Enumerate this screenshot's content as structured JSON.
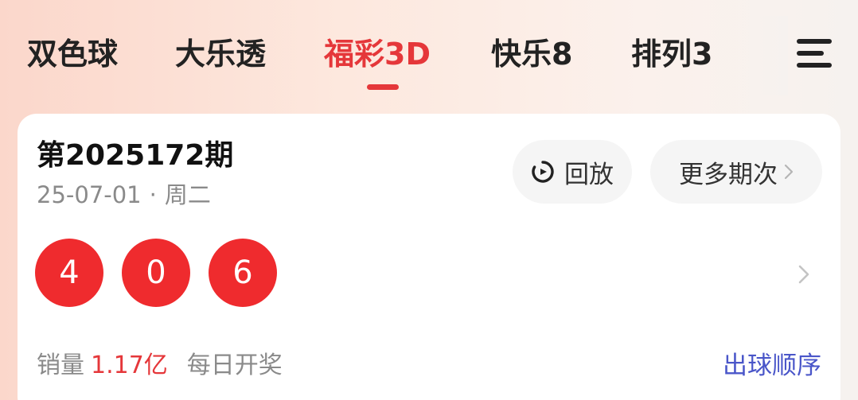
{
  "tabs": [
    {
      "label": "双色球",
      "active": false
    },
    {
      "label": "大乐透",
      "active": false
    },
    {
      "label": "福彩3D",
      "active": true
    },
    {
      "label": "快乐8",
      "active": false
    },
    {
      "label": "排列3",
      "active": false
    }
  ],
  "menu_icon": "hamburger-menu-icon",
  "draw": {
    "issue": "第2025172期",
    "date": "25-07-01",
    "separator": "·",
    "weekday": "周二",
    "replay_label": "回放",
    "replay_icon": "replay-icon",
    "more_label": "更多期次",
    "numbers": [
      "4",
      "0",
      "6"
    ],
    "sales_label": "销量",
    "sales_value": "1.17亿",
    "frequency": "每日开奖",
    "order_link": "出球顺序"
  },
  "colors": {
    "accent": "#e5373a",
    "ball": "#ef2b2e",
    "link": "#4a56c9",
    "muted_text": "#8a8a8a"
  }
}
